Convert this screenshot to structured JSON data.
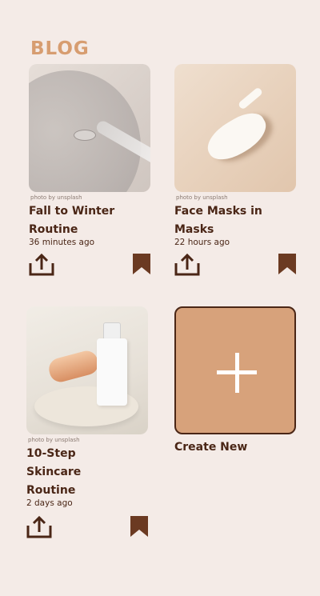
{
  "header": {
    "title": "BLOG"
  },
  "posts": [
    {
      "credit": "photo by unsplash",
      "title": "Fall to Winter Routine",
      "time": "36 minutes ago"
    },
    {
      "credit": "photo by unsplash",
      "title": "Face Masks in Masks",
      "time": "22 hours ago"
    },
    {
      "credit": "photo by unsplash",
      "title": "10-Step Skincare Routine",
      "time": "2 days ago"
    }
  ],
  "create": {
    "label": "Create New"
  },
  "colors": {
    "background": "#f4ebe7",
    "accent": "#d79d70",
    "text": "#4a2616",
    "tile": "#d7a27b"
  },
  "icons": {
    "share": "share-icon",
    "bookmark": "bookmark-icon",
    "plus": "plus-icon"
  }
}
